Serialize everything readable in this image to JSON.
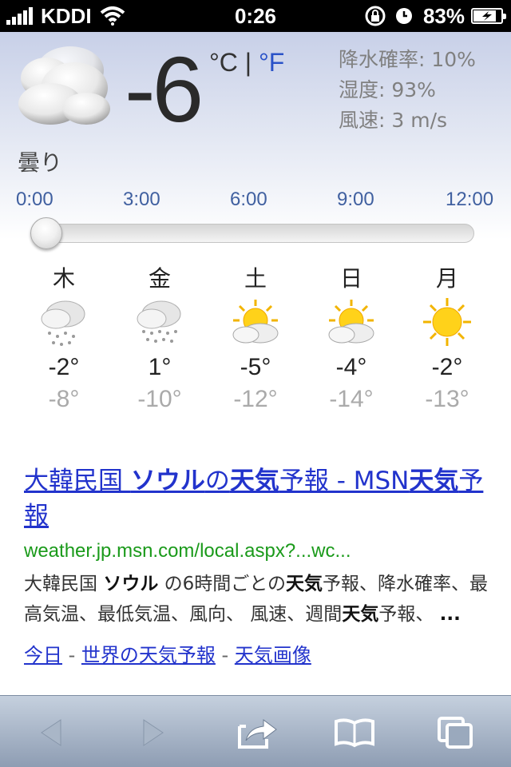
{
  "status_bar": {
    "carrier": "KDDI",
    "time": "0:26",
    "battery_percent": "83%",
    "signal_icon": "signal-bars-icon",
    "wifi_icon": "wifi-icon",
    "lock_icon": "rotation-lock-icon",
    "alarm_icon": "alarm-icon",
    "battery_icon": "battery-charging-icon"
  },
  "weather": {
    "current_icon": "cloudy-icon",
    "temperature": "-6",
    "unit_c": "°C",
    "unit_sep": "|",
    "unit_f": "°F",
    "precip": "降水確率: 10%",
    "humidity": "湿度: 93%",
    "wind": "風速: 3 m/s",
    "condition": "曇り",
    "timeline": [
      "0:00",
      "3:00",
      "6:00",
      "9:00",
      "12:00"
    ],
    "slider_position": 0,
    "forecast": [
      {
        "day": "木",
        "icon": "snow-icon",
        "high": "-2°",
        "low": "-8°"
      },
      {
        "day": "金",
        "icon": "snow-icon",
        "high": "1°",
        "low": "-10°"
      },
      {
        "day": "土",
        "icon": "partly-sunny-icon",
        "high": "-5°",
        "low": "-12°"
      },
      {
        "day": "日",
        "icon": "partly-sunny-icon",
        "high": "-4°",
        "low": "-14°"
      },
      {
        "day": "月",
        "icon": "sunny-icon",
        "high": "-2°",
        "low": "-13°"
      }
    ]
  },
  "result": {
    "title_parts": [
      "大韓民国 ",
      "ソウル",
      "の",
      "天気",
      "予報 - MSN",
      "天気",
      "予報"
    ],
    "url": "weather.jp.msn.com/local.aspx?...wc...",
    "snippet_parts": [
      "大韓民国 ",
      "ソウル",
      " の6時間ごとの",
      "天気",
      "予報、降水確率、最高気温、最低気温、風向、 風速、週間",
      "天気",
      "予報、 ",
      "..."
    ],
    "links": [
      "今日",
      "世界の天気予報",
      "天気画像"
    ],
    "link_sep": " - "
  },
  "toolbar": {
    "back_icon": "back-arrow-icon",
    "forward_icon": "forward-arrow-icon",
    "share_icon": "share-icon",
    "bookmarks_icon": "bookmarks-icon",
    "tabs_icon": "tabs-icon"
  },
  "colors": {
    "link": "#2233cc",
    "url": "#1a9a1a",
    "unit_f": "#2a52c8"
  }
}
